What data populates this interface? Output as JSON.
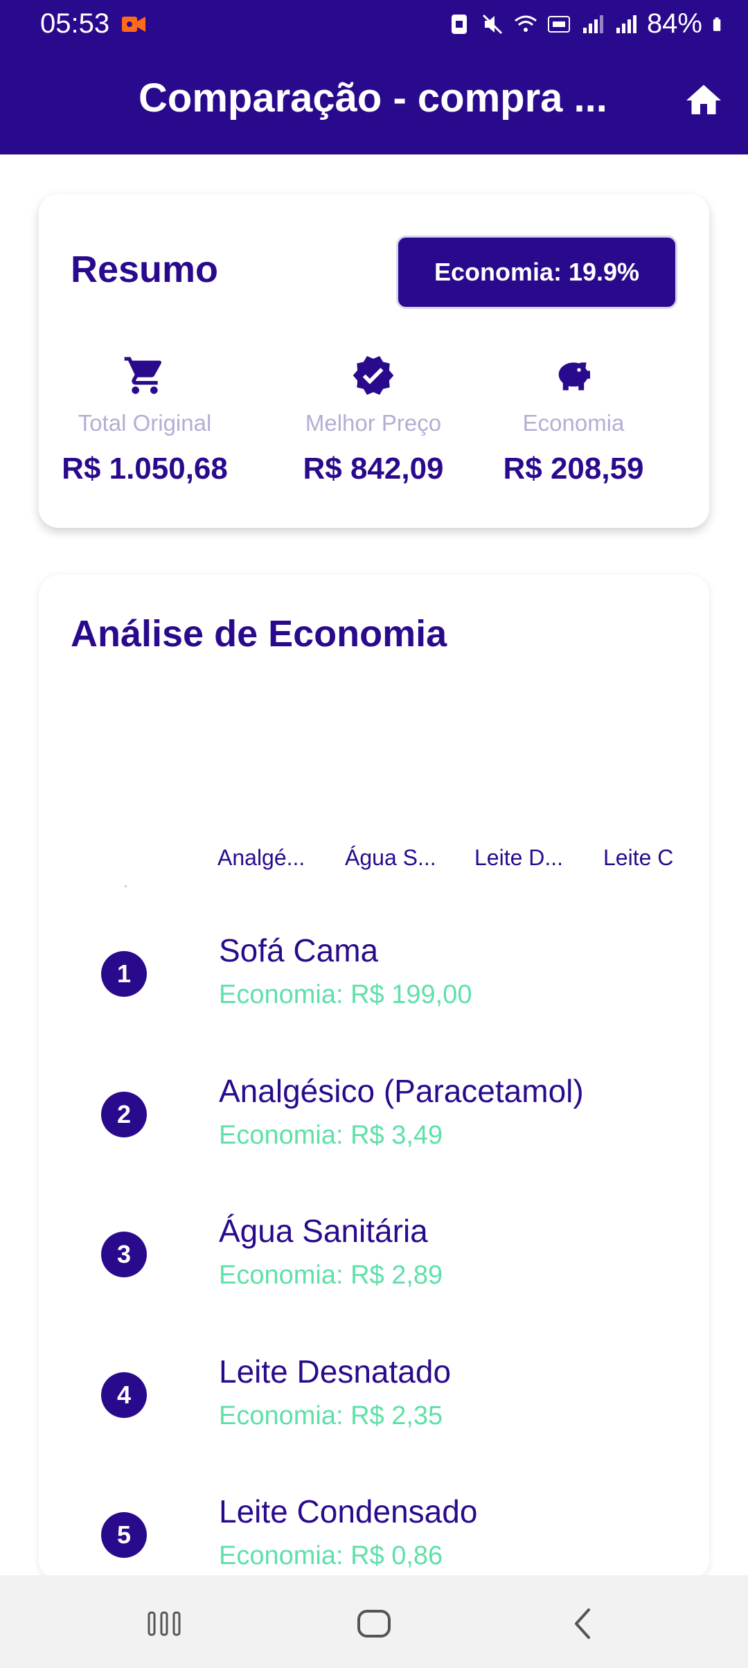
{
  "status_bar": {
    "time": "05:53",
    "battery": "84%"
  },
  "header": {
    "title": "Comparação - compra ...",
    "home_icon": "home-icon"
  },
  "summary": {
    "title": "Resumo",
    "badge": "Economia: 19.9%",
    "stats": [
      {
        "icon": "cart-icon",
        "label": "Total Original",
        "value": "R$ 1.050,68"
      },
      {
        "icon": "verified-badge-icon",
        "label": "Melhor Preço",
        "value": "R$ 842,09"
      },
      {
        "icon": "piggy-bank-icon",
        "label": "Economia",
        "value": "R$ 208,59"
      }
    ]
  },
  "analysis": {
    "title": "Análise de Economia",
    "axis_labels": [
      "Analgé...",
      "Água S...",
      "Leite D...",
      "Leite C"
    ],
    "items": [
      {
        "rank": "1",
        "name": "Sofá Cama",
        "economy": "Economia: R$ 199,00"
      },
      {
        "rank": "2",
        "name": "Analgésico (Paracetamol)",
        "economy": "Economia: R$ 3,49"
      },
      {
        "rank": "3",
        "name": "Água Sanitária",
        "economy": "Economia: R$ 2,89"
      },
      {
        "rank": "4",
        "name": "Leite Desnatado",
        "economy": "Economia: R$ 2,35"
      },
      {
        "rank": "5",
        "name": "Leite Condensado",
        "economy": "Economia: R$ 0,86"
      }
    ]
  },
  "colors": {
    "primary": "#2a0a8c",
    "accent_green": "#5fe0a8",
    "muted_label": "#b3aed4"
  }
}
